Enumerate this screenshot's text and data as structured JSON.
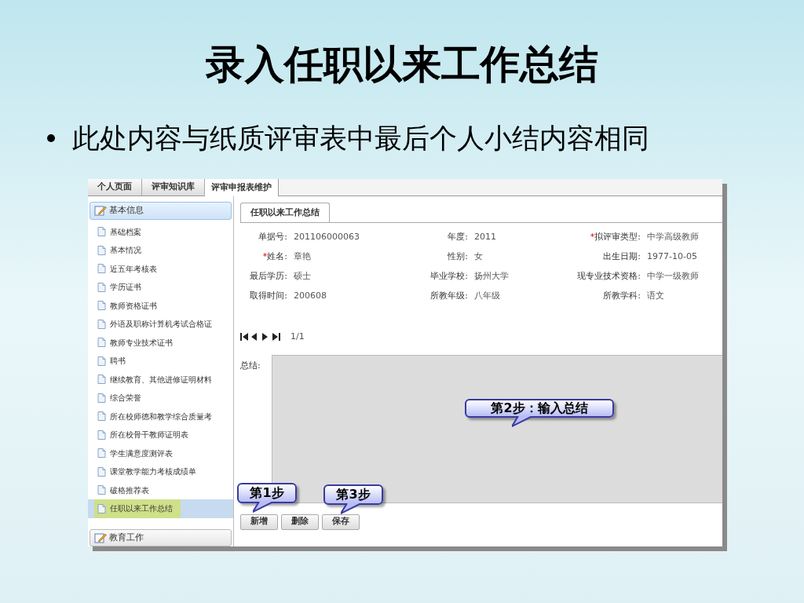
{
  "slide": {
    "title": "录入任职以来工作总结",
    "bullet": "此处内容与纸质评审表中最后个人小结内容相同"
  },
  "top_tabs": [
    {
      "label": "个人页面",
      "selected": false
    },
    {
      "label": "评审知识库",
      "selected": false
    },
    {
      "label": "评审申报表维护",
      "selected": true
    }
  ],
  "sidebar": {
    "sections": [
      {
        "label": "基本信息",
        "expanded": true,
        "items": [
          {
            "label": "基础档案",
            "selected": false
          },
          {
            "label": "基本情况",
            "selected": false
          },
          {
            "label": "近五年考核表",
            "selected": false
          },
          {
            "label": "学历证书",
            "selected": false
          },
          {
            "label": "教师资格证书",
            "selected": false
          },
          {
            "label": "外语及职称计算机考试合格证",
            "selected": false
          },
          {
            "label": "教师专业技术证书",
            "selected": false
          },
          {
            "label": "聘书",
            "selected": false
          },
          {
            "label": "继续教育、其他进修证明材料",
            "selected": false
          },
          {
            "label": "综合荣誉",
            "selected": false
          },
          {
            "label": "所在校师德和教学综合质量考",
            "selected": false
          },
          {
            "label": "所在校骨干教师证明表",
            "selected": false
          },
          {
            "label": "学生满意度测评表",
            "selected": false
          },
          {
            "label": "课堂教学能力考核成绩单",
            "selected": false
          },
          {
            "label": "破格推荐表",
            "selected": false
          },
          {
            "label": "任职以来工作总结",
            "selected": true
          }
        ]
      },
      {
        "label": "教育工作",
        "expanded": false
      }
    ]
  },
  "panel": {
    "tab": "任职以来工作总结",
    "form_rows": [
      [
        {
          "label": "单据号:",
          "value": "201106000063"
        },
        {
          "label": "年度:",
          "value": "2011"
        },
        {
          "label": "拟评审类型:",
          "value": "中学高级教师",
          "required_mark": "*"
        }
      ],
      [
        {
          "label": "姓名:",
          "value": "章艳",
          "required_mark": "*"
        },
        {
          "label": "性别:",
          "value": "女"
        },
        {
          "label": "出生日期:",
          "value": "1977-10-05"
        }
      ],
      [
        {
          "label": "最后学历:",
          "value": "硕士"
        },
        {
          "label": "毕业学校:",
          "value": "扬州大学"
        },
        {
          "label": "现专业技术资格:",
          "value": "中学一级教师"
        }
      ],
      [
        {
          "label": "取得时间:",
          "value": "200608"
        },
        {
          "label": "所教年级:",
          "value": "八年级"
        },
        {
          "label": "所教学科:",
          "value": "语文"
        }
      ]
    ],
    "pager": "1/1",
    "summary_label": "总结:",
    "buttons": [
      "新增",
      "删除",
      "保存"
    ]
  },
  "callouts": [
    {
      "kind": "step2",
      "text": "第2步：输入总结"
    },
    {
      "kind": "step1",
      "text": "第1步"
    },
    {
      "kind": "step3",
      "text": "第3步"
    }
  ]
}
